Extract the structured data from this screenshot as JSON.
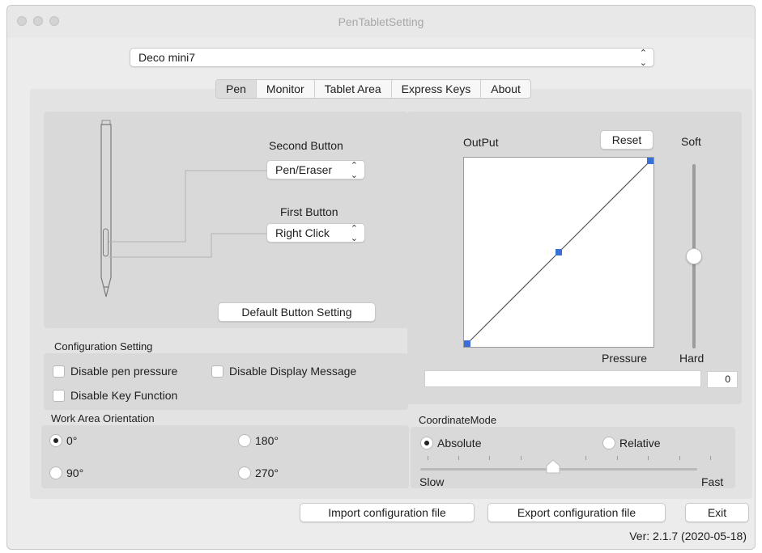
{
  "window": {
    "title": "PenTabletSetting"
  },
  "device": {
    "selected": "Deco mini7"
  },
  "tabs": [
    {
      "label": "Pen"
    },
    {
      "label": "Monitor"
    },
    {
      "label": "Tablet Area"
    },
    {
      "label": "Express Keys"
    },
    {
      "label": "About"
    }
  ],
  "pen_buttons": {
    "second_label": "Second Button",
    "second_value": "Pen/Eraser",
    "first_label": "First Button",
    "first_value": "Right Click",
    "default_button": "Default  Button Setting"
  },
  "config": {
    "title": "Configuration Setting",
    "disable_pressure": "Disable pen pressure",
    "disable_display": "Disable Display Message",
    "disable_key": "Disable Key Function"
  },
  "orientation": {
    "title": "Work Area Orientation",
    "options": [
      "0°",
      "180°",
      "90°",
      "270°"
    ],
    "selected": "0°"
  },
  "pressure_curve": {
    "output_label": "OutPut",
    "reset_label": "Reset",
    "soft_label": "Soft",
    "hard_label": "Hard",
    "pressure_label": "Pressure",
    "pressure_value": "0",
    "curve_points": [
      [
        0,
        0
      ],
      [
        0.5,
        0.5
      ],
      [
        1,
        1
      ]
    ],
    "softness_level": 0.5,
    "handle_color": "#3a6fd8"
  },
  "coordinate": {
    "title": "CoordinateMode",
    "absolute": "Absolute",
    "relative": "Relative",
    "selected": "Absolute",
    "slow": "Slow",
    "fast": "Fast",
    "speed_fraction": 0.48
  },
  "footer": {
    "import": "Import configuration file",
    "export": "Export configuration file",
    "exit": "Exit",
    "version": "Ver: 2.1.7 (2020-05-18)"
  }
}
